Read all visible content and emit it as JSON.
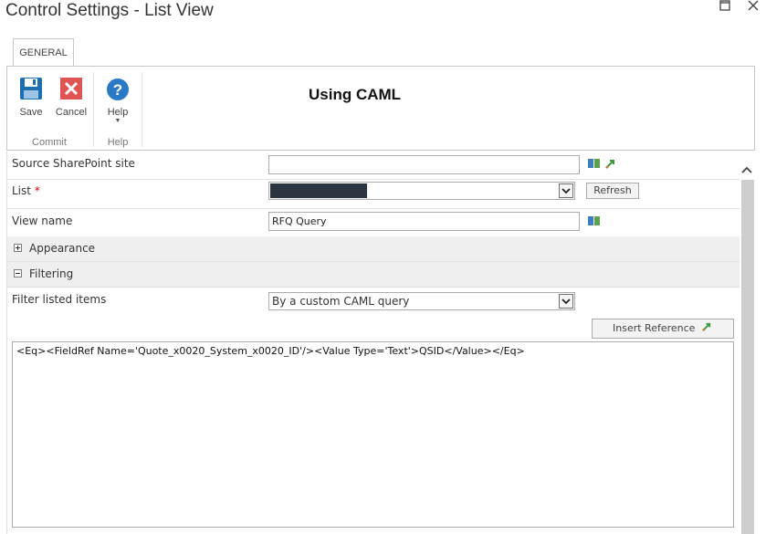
{
  "window": {
    "title": "Control Settings - List View"
  },
  "ribbon": {
    "tab": "GENERAL",
    "buttons": {
      "save": "Save",
      "cancel": "Cancel",
      "help": "Help"
    },
    "groups": {
      "commit": "Commit",
      "help": "Help"
    },
    "caption": "Using CAML"
  },
  "form": {
    "source_site": {
      "label": "Source SharePoint site",
      "value": ""
    },
    "list": {
      "label": "List",
      "required_mark": "*",
      "refresh_label": "Refresh"
    },
    "view_name": {
      "label": "View name",
      "value": "RFQ Query"
    },
    "appearance": {
      "label": "Appearance",
      "toggle": "+"
    },
    "filtering": {
      "label": "Filtering",
      "toggle": "−"
    },
    "filter_items": {
      "label": "Filter listed items",
      "selected": "By a custom CAML query"
    },
    "insert_reference_label": "Insert Reference",
    "caml_query": "<Eq><FieldRef Name='Quote_x0020_System_x0020_ID'/><Value Type='Text'>QSID</Value></Eq>"
  },
  "colors": {
    "save_icon": "#1e6fb0",
    "cancel_icon": "#e05454",
    "help_icon": "#2a79c4",
    "list_value_fill": "#2b3542"
  }
}
